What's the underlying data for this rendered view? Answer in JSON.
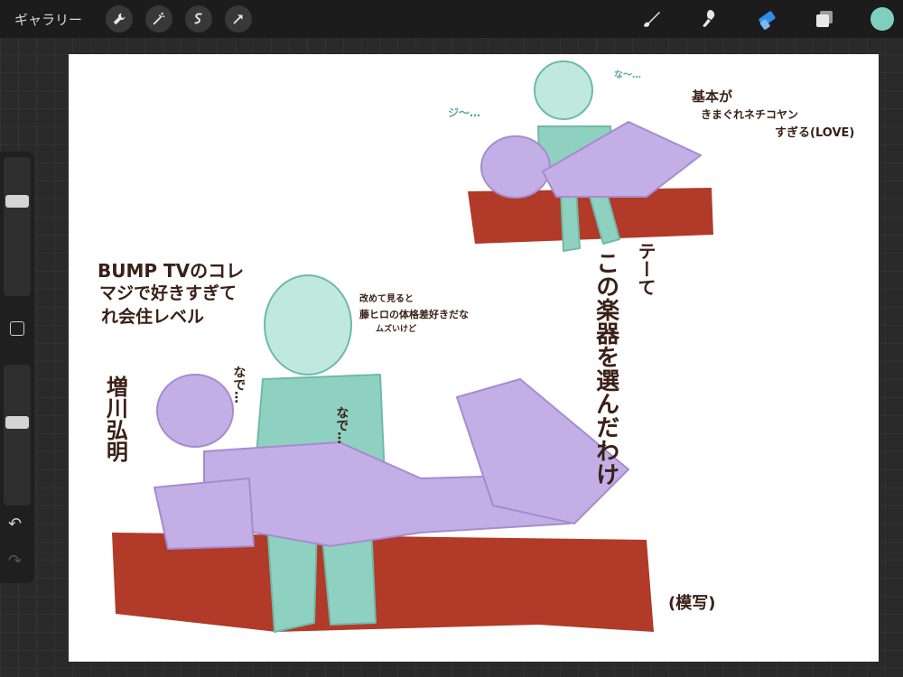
{
  "app": {
    "gallery_label": "ギャラリー",
    "left_tools": [
      {
        "icon": "wrench-icon",
        "label": "Actions"
      },
      {
        "icon": "magic-wand-icon",
        "label": "Adjustments"
      },
      {
        "icon": "selection-icon",
        "label": "Selection"
      },
      {
        "icon": "arrow-cursor-icon",
        "label": "Transform"
      }
    ],
    "right_tools": [
      {
        "icon": "brush-icon",
        "active": false
      },
      {
        "icon": "smudge-icon",
        "active": false
      },
      {
        "icon": "eraser-icon",
        "active": true
      },
      {
        "icon": "layers-icon",
        "active": false
      }
    ],
    "current_color": "#7fcfc0",
    "active_tool_color": "#2f8fe8"
  },
  "sidebar": {
    "brush_size": 0.7,
    "opacity": 0.6,
    "undo_icon": "undo-icon",
    "redo_icon": "redo-icon",
    "modify_icon": "square-icon"
  },
  "canvas": {
    "notes": {
      "top_right_line1": "基本が",
      "top_right_line2": "きまぐれネチコヤン",
      "top_right_line3": "すぎる(LOVE)",
      "left_line1": "BUMP TVのコレ",
      "left_line2": "マジで好きすぎて",
      "left_line3": "れ会住レベル",
      "name_vertical": "増川弘明",
      "middle_line1": "改めて見ると",
      "middle_line2": "藤ヒロの体格差好きだな",
      "middle_line3": "ムズいけど",
      "nade1": "なで…",
      "nade2": "なで…",
      "vertical_col1": "テーて",
      "vertical_col2": "この楽器を選んだわけ",
      "mosha": "(模写)",
      "ji_sound": "ジ〜…",
      "naa": "な〜…"
    },
    "colors": {
      "red": "#b23a28",
      "teal": "#8fd1c0",
      "purple": "#c3aee6",
      "ink": "#3a2016"
    }
  }
}
